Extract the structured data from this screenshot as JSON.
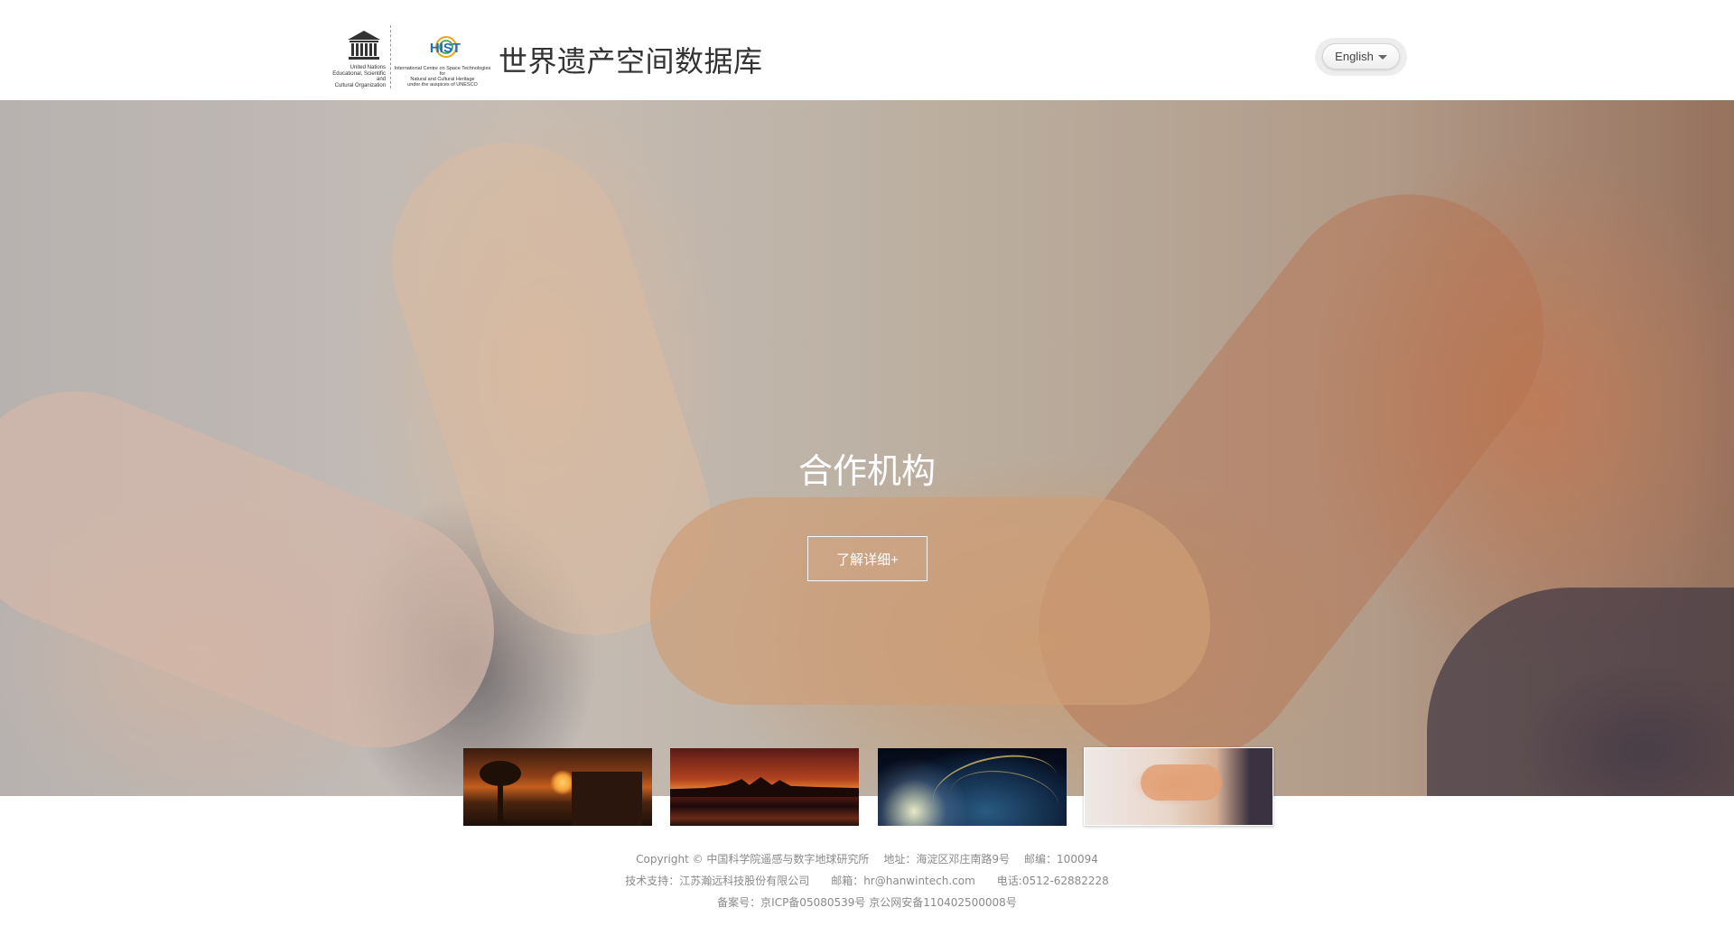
{
  "header": {
    "unesco_logo": {
      "icon": "unesco-temple-icon",
      "text_lines": [
        "United Nations",
        "Educational, Scientific and",
        "Cultural Organization"
      ]
    },
    "hist_logo": {
      "icon": "hist-logo-icon",
      "mark_text": "HIST",
      "text_lines": [
        "International Centre on Space Technologies for",
        "Natural and Cultural Heritage",
        "under the auspices of UNESCO"
      ]
    },
    "site_title": "世界遗产空间数据库",
    "language": {
      "selected": "English",
      "icon": "caret-down-icon"
    }
  },
  "hero": {
    "title": "合作机构",
    "button_label": "了解详细+"
  },
  "thumbnails": [
    {
      "name": "sunset-temple-ruins"
    },
    {
      "name": "angkor-wat-silhouette"
    },
    {
      "name": "earth-network-lights"
    },
    {
      "name": "stacked-hands",
      "selected": true
    }
  ],
  "footer": {
    "copyright": "Copyright © 中国科学院遥感与数字地球研究所",
    "address": "地址：海淀区邓庄南路9号",
    "postcode": "邮编：100094",
    "tech_support": "技术支持：江苏瀚远科技股份有限公司",
    "email": "邮箱：hr@hanwintech.com",
    "phone": "电话:0512-62882228",
    "icp": "备案号：京ICP备05080539号 京公网安备110402500008号"
  }
}
